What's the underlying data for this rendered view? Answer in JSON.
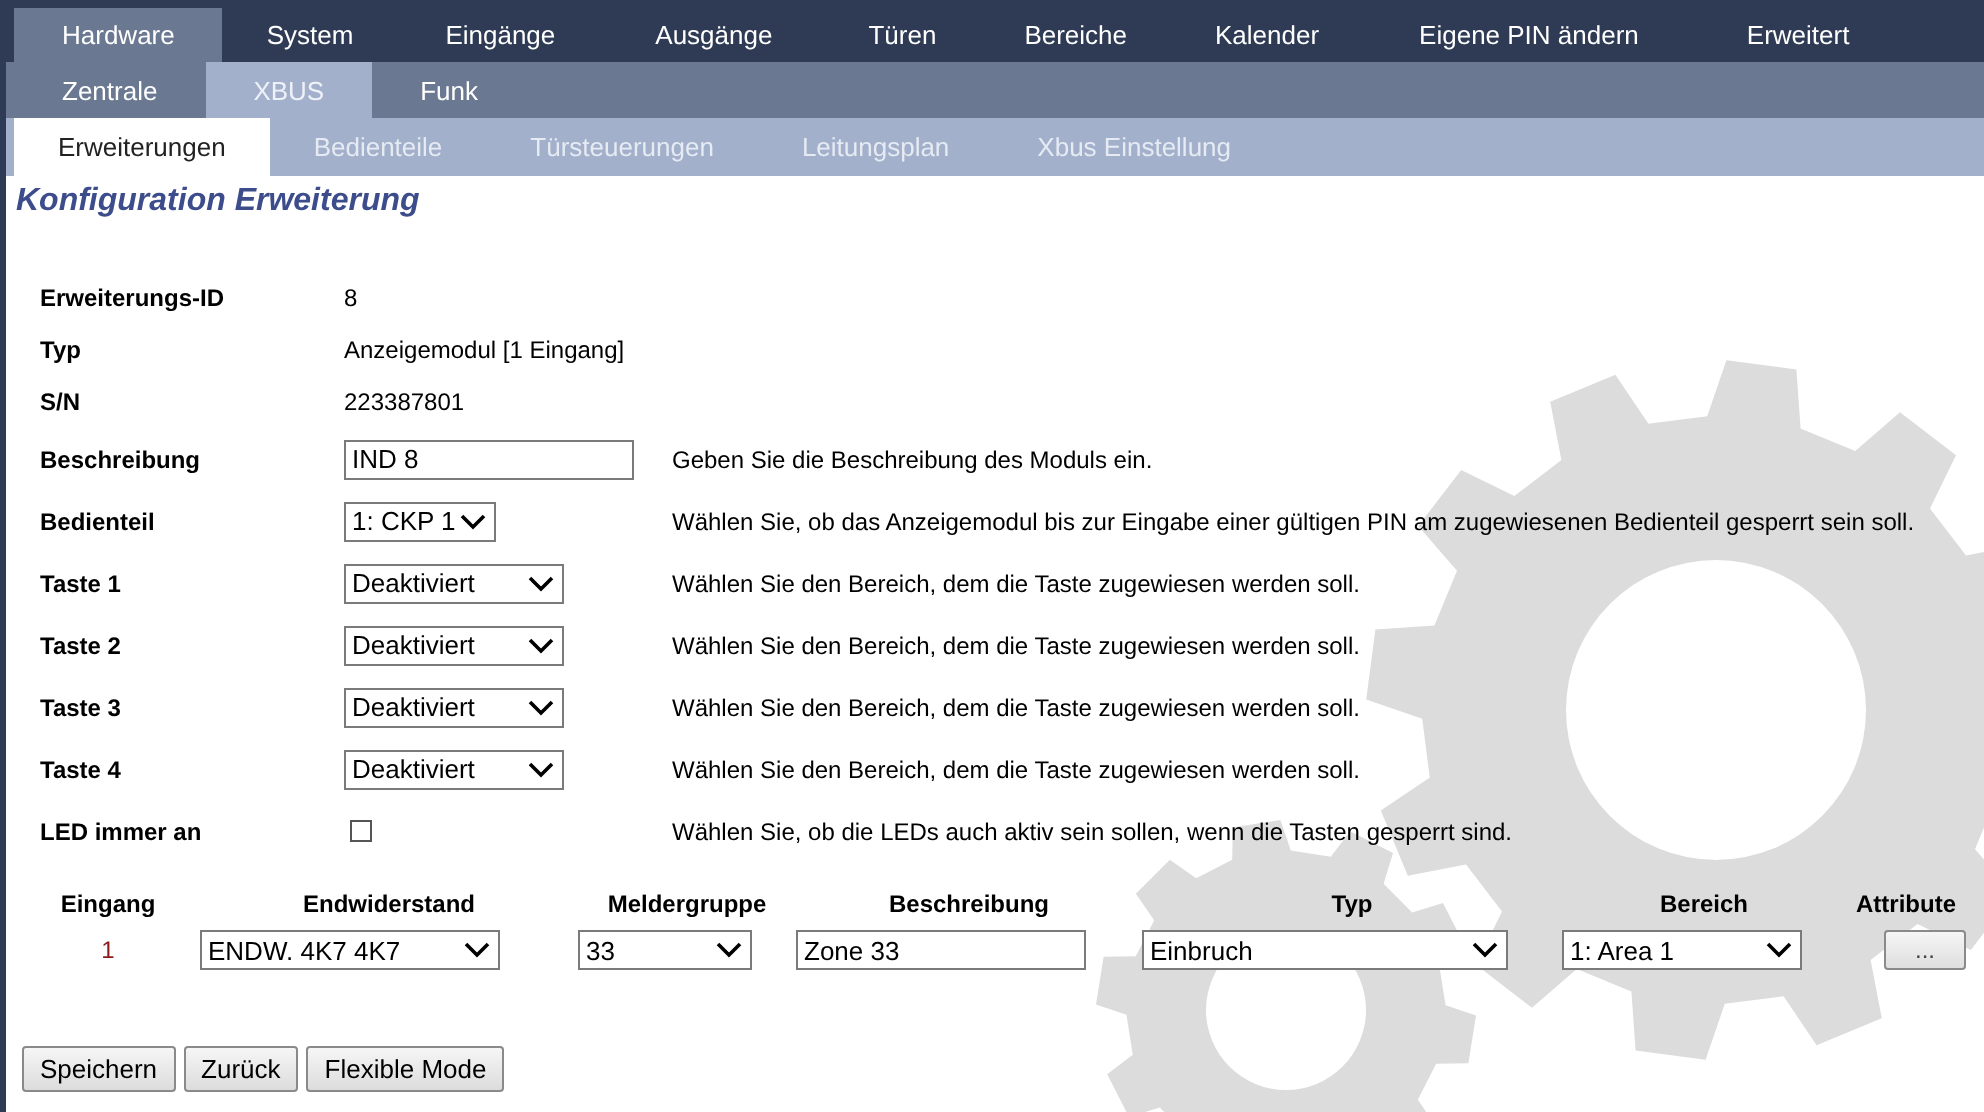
{
  "main_tabs": [
    {
      "label": "Hardware",
      "selected": true
    },
    {
      "label": "System",
      "selected": false
    },
    {
      "label": "Eingänge",
      "selected": false
    },
    {
      "label": "Ausgänge",
      "selected": false
    },
    {
      "label": "Türen",
      "selected": false
    },
    {
      "label": "Bereiche",
      "selected": false
    },
    {
      "label": "Kalender",
      "selected": false
    },
    {
      "label": "Eigene PIN ändern",
      "selected": false
    },
    {
      "label": "Erweitert",
      "selected": false
    }
  ],
  "sub_tabs": [
    {
      "label": "Zentrale",
      "selected": false
    },
    {
      "label": "XBUS",
      "selected": true
    },
    {
      "label": "Funk",
      "selected": false
    }
  ],
  "section_tabs": [
    {
      "label": "Erweiterungen",
      "selected": true
    },
    {
      "label": "Bedienteile",
      "selected": false
    },
    {
      "label": "Türsteuerungen",
      "selected": false
    },
    {
      "label": "Leitungsplan",
      "selected": false
    },
    {
      "label": "Xbus Einstellung",
      "selected": false
    }
  ],
  "title": "Konfiguration Erweiterung",
  "fields": [
    {
      "kind": "text",
      "label": "Erweiterungs-ID",
      "value": "8"
    },
    {
      "kind": "text",
      "label": "Typ",
      "value": "Anzeigemodul [1 Eingang]"
    },
    {
      "kind": "text",
      "label": "S/N",
      "value": "223387801"
    },
    {
      "kind": "input",
      "label": "Beschreibung",
      "value": "IND 8",
      "help": "Geben Sie die Beschreibung des Moduls ein."
    },
    {
      "kind": "select",
      "label": "Bedienteil",
      "value": "1: CKP 1",
      "help": "Wählen Sie, ob das Anzeigemodul bis zur Eingabe einer gültigen PIN am zugewiesenen Bedienteil gesperrt sein soll."
    },
    {
      "kind": "select",
      "label": "Taste 1",
      "value": "Deaktiviert",
      "help": "Wählen Sie den Bereich, dem die Taste zugewiesen werden soll."
    },
    {
      "kind": "select",
      "label": "Taste 2",
      "value": "Deaktiviert",
      "help": "Wählen Sie den Bereich, dem die Taste zugewiesen werden soll."
    },
    {
      "kind": "select",
      "label": "Taste 3",
      "value": "Deaktiviert",
      "help": "Wählen Sie den Bereich, dem die Taste zugewiesen werden soll."
    },
    {
      "kind": "select",
      "label": "Taste 4",
      "value": "Deaktiviert",
      "help": "Wählen Sie den Bereich, dem die Taste zugewiesen werden soll."
    },
    {
      "kind": "checkbox",
      "label": "LED immer an",
      "checked": false,
      "help": "Wählen Sie, ob die LEDs auch aktiv sein sollen, wenn die Tasten gesperrt sind."
    }
  ],
  "inputs_table": {
    "columns": [
      "Eingang",
      "Endwiderstand",
      "Meldergruppe",
      "Beschreibung",
      "Typ",
      "Bereich",
      "Attribute"
    ],
    "rows": [
      {
        "eingang": "1",
        "endwiderstand": "ENDW. 4K7 4K7",
        "meldergruppe": "33",
        "beschreibung": "Zone 33",
        "typ": "Einbruch",
        "bereich": "1: Area 1",
        "attribute": "..."
      }
    ]
  },
  "buttons": [
    "Speichern",
    "Zurück",
    "Flexible Mode"
  ]
}
